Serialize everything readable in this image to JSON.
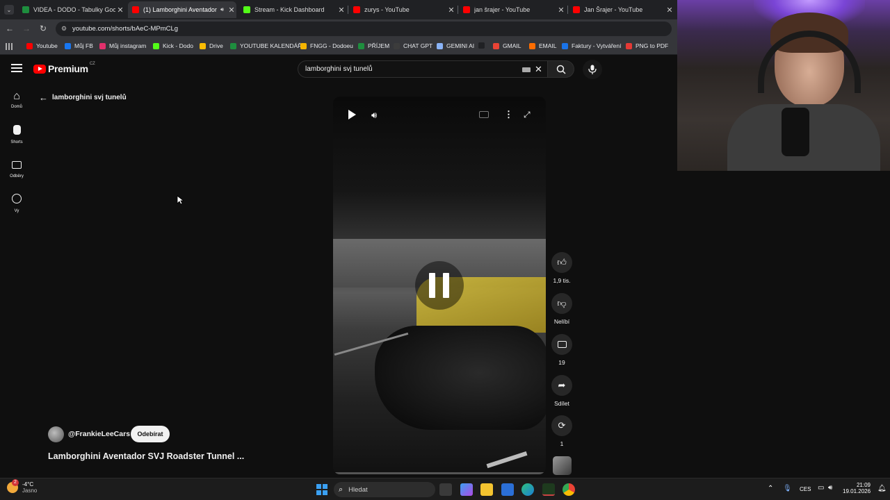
{
  "browser": {
    "tabs": [
      {
        "title": "VIDEA - DODO - Tabulky Googl",
        "favicon_color": "#1e8e3e"
      },
      {
        "title": "(1) Lamborghini Aventador",
        "favicon_color": "#ff0000"
      },
      {
        "title": "Stream - Kick Dashboard",
        "favicon_color": "#53fc18"
      },
      {
        "title": "zurys - YouTube",
        "favicon_color": "#ff0000"
      },
      {
        "title": "jan šrajer - YouTube",
        "favicon_color": "#ff0000"
      },
      {
        "title": "Jan Šrajer - YouTube",
        "favicon_color": "#ff0000"
      }
    ],
    "url": "youtube.com/shorts/bAeC-MPmCLg",
    "bookmarks": [
      {
        "label": "Youtube",
        "color": "#ff0000"
      },
      {
        "label": "Můj FB",
        "color": "#1877f2"
      },
      {
        "label": "Můj instagram",
        "color": "#e1306c"
      },
      {
        "label": "Kick - Dodo",
        "color": "#53fc18"
      },
      {
        "label": "Drive",
        "color": "#fbbc04"
      },
      {
        "label": "YOUTUBE KALENDÁŘ",
        "color": "#1e8e3e"
      },
      {
        "label": "FNGG - Dodoeu",
        "color": "#f4b400"
      },
      {
        "label": "PŘÍJEM",
        "color": "#1e8e3e"
      },
      {
        "label": "CHAT GPT",
        "color": "#3c3c3c"
      },
      {
        "label": "GEMINI AI",
        "color": "#8ab4f8"
      },
      {
        "label": "",
        "color": "#202124"
      },
      {
        "label": "GMAIL",
        "color": "#ea4335"
      },
      {
        "label": "EMAIL",
        "color": "#ff6d00"
      },
      {
        "label": "Faktury - Vytváření",
        "color": "#1a73e8"
      },
      {
        "label": "PNG to PDF",
        "color": "#e53935"
      }
    ]
  },
  "youtube": {
    "logo_text": "Premium",
    "logo_region": "CZ",
    "search_value": "lamborghini svj tunelů",
    "back_query": "lamborghini svj tunelů",
    "nav": [
      {
        "label": "Domů",
        "icon": "home-icon"
      },
      {
        "label": "Shorts",
        "icon": "shorts-icon"
      },
      {
        "label": "Odběry",
        "icon": "subscriptions-icon"
      },
      {
        "label": "Vy",
        "icon": "you-icon"
      }
    ],
    "channel": "@FrankieLeeCars",
    "subscribe_label": "Odebírat",
    "video_title": "Lamborghini Aventador SVJ Roadster Tunnel ...",
    "actions": {
      "likes": "1,9 tis.",
      "dislike": "Nelíbí",
      "comments": "19",
      "share": "Sdílet",
      "remix": "1"
    }
  },
  "taskbar": {
    "weather_temp": "-4°C",
    "weather_desc": "Jasno",
    "weather_badge": "2",
    "search_placeholder": "Hledat",
    "lang": "CES",
    "time": "21:09",
    "date": "19.01.2026"
  }
}
